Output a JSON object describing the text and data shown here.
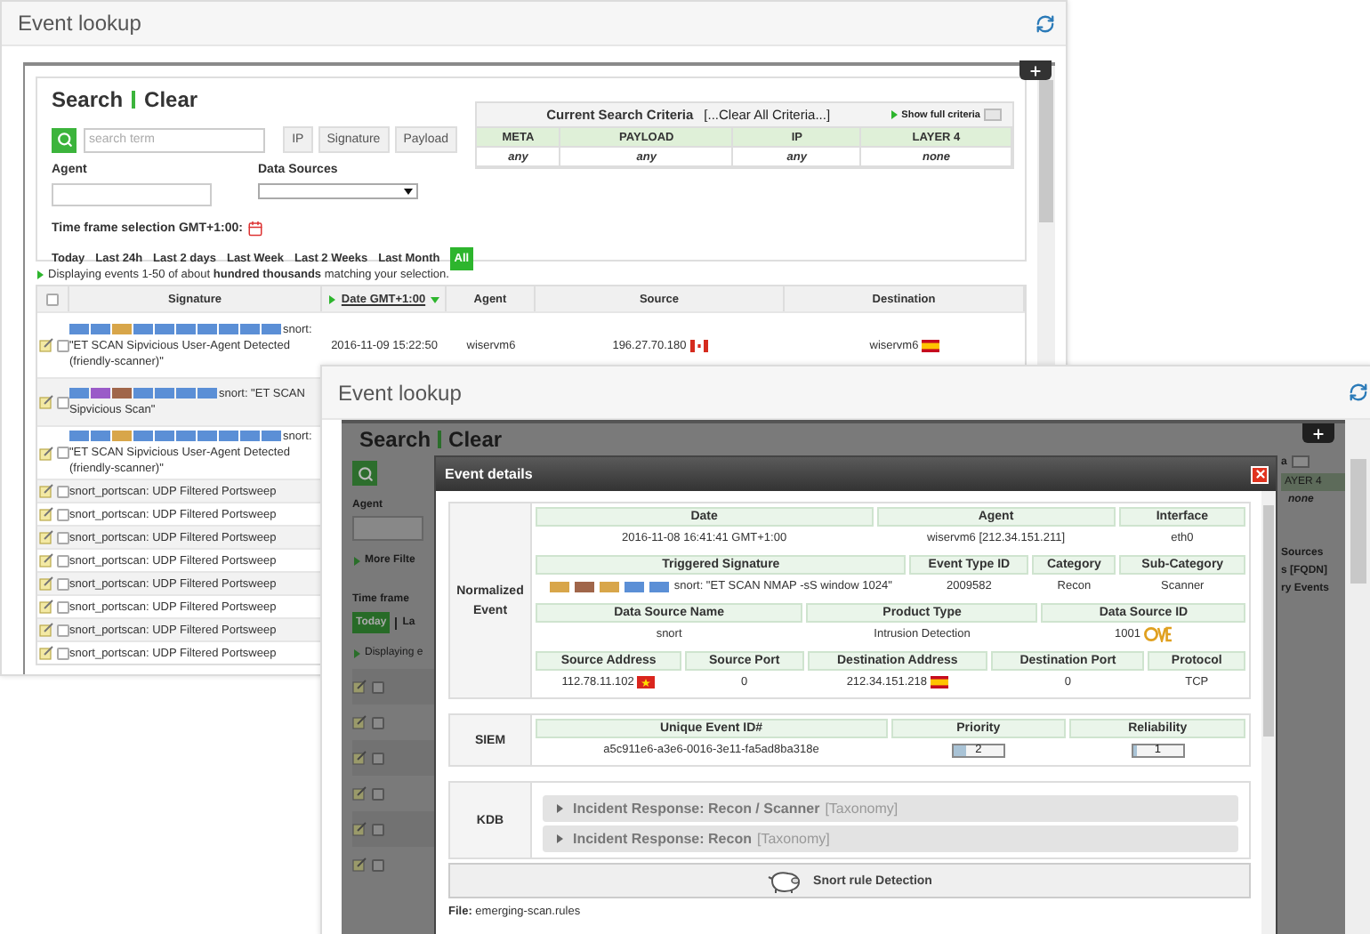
{
  "back_window": {
    "title": "Event lookup",
    "search": {
      "title": "Search",
      "clear": "Clear",
      "placeholder": "search term",
      "filter_buttons": [
        "IP",
        "Signature",
        "Payload"
      ],
      "agent_label": "Agent",
      "sources_label": "Data Sources",
      "timeframe_label": "Time frame selection GMT+1:00:",
      "time_links": [
        {
          "label": "Today",
          "selected": false
        },
        {
          "label": "Last 24h",
          "selected": false
        },
        {
          "label": "Last 2 days",
          "selected": false
        },
        {
          "label": "Last Week",
          "selected": false
        },
        {
          "label": "Last 2 Weeks",
          "selected": false
        },
        {
          "label": "Last Month",
          "selected": false
        },
        {
          "label": "All",
          "selected": true
        }
      ]
    },
    "criteria": {
      "title": "Current Search Criteria",
      "clear_link": "[...Clear All Criteria...]",
      "show_full": "Show full criteria",
      "columns": [
        "META",
        "PAYLOAD",
        "IP",
        "LAYER 4"
      ],
      "values": [
        "any",
        "any",
        "any",
        "none"
      ]
    },
    "status": "Displaying events 1-50 of about **hundred thousands** matching your selection.",
    "table": {
      "all_checked": false,
      "columns": [
        "Signature",
        "Date GMT+1:00",
        "Agent",
        "Source",
        "Destination"
      ],
      "rows": [
        {
          "checked": false,
          "tags": [
            {
              "color": "#5b8fd6"
            },
            {
              "color": "#5b8fd6"
            },
            {
              "color": "#d8a64a"
            },
            {
              "color": "#5b8fd6"
            },
            {
              "color": "#5b8fd6"
            },
            {
              "color": "#5b8fd6"
            },
            {
              "color": "#5b8fd6"
            },
            {
              "color": "#5b8fd6"
            },
            {
              "color": "#5b8fd6"
            },
            {
              "color": "#5b8fd6"
            }
          ],
          "signature": "snort: \"ET SCAN Sipvicious User-Agent Detected (friendly-scanner)\"",
          "date": "2016-11-09 15:22:50",
          "agent": "wiservm6",
          "source": "196.27.70.180",
          "source_flag": {
            "kind": "ca"
          },
          "destination": "wiservm6",
          "destination_flag": {
            "kind": "es"
          }
        },
        {
          "checked": false,
          "tags": [
            {
              "color": "#5b8fd6"
            },
            {
              "color": "#9a5bc8"
            },
            {
              "color": "#a0664a"
            },
            {
              "color": "#5b8fd6"
            },
            {
              "color": "#5b8fd6"
            },
            {
              "color": "#5b8fd6"
            },
            {
              "color": "#5b8fd6"
            }
          ],
          "signature": "snort: \"ET SCAN Sipvicious Scan\""
        },
        {
          "checked": false,
          "tags": [
            {
              "color": "#5b8fd6"
            },
            {
              "color": "#5b8fd6"
            },
            {
              "color": "#d8a64a"
            },
            {
              "color": "#5b8fd6"
            },
            {
              "color": "#5b8fd6"
            },
            {
              "color": "#5b8fd6"
            },
            {
              "color": "#5b8fd6"
            },
            {
              "color": "#5b8fd6"
            },
            {
              "color": "#5b8fd6"
            },
            {
              "color": "#5b8fd6"
            }
          ],
          "signature": "snort: \"ET SCAN Sipvicious User-Agent Detected (friendly-scanner)\""
        },
        {
          "checked": false,
          "signature": "snort_portscan: UDP Filtered Portsweep"
        },
        {
          "checked": false,
          "signature": "snort_portscan: UDP Filtered Portsweep"
        },
        {
          "checked": false,
          "signature": "snort_portscan: UDP Filtered Portsweep"
        },
        {
          "checked": false,
          "signature": "snort_portscan: UDP Filtered Portsweep"
        },
        {
          "checked": false,
          "signature": "snort_portscan: UDP Filtered Portsweep"
        },
        {
          "checked": false,
          "signature": "snort_portscan: UDP Filtered Portsweep"
        },
        {
          "checked": false,
          "signature": "snort_portscan: UDP Filtered Portsweep"
        },
        {
          "checked": false,
          "signature": "snort_portscan: UDP Filtered Portsweep"
        }
      ]
    }
  },
  "front_window": {
    "title": "Event lookup",
    "dimmed_top": {
      "search": "Search",
      "clear": "Clear"
    },
    "dimmed_left": {
      "agent_label": "Agent",
      "more_filters": "More Filte",
      "time_frame": "Time frame",
      "time_links": [
        {
          "label": "Today",
          "selected": true
        },
        {
          "label": "La",
          "selected": false
        }
      ],
      "status": "Displaying e",
      "rows": [
        {
          "checked": false
        },
        {
          "checked": false
        },
        {
          "checked": false
        },
        {
          "checked": false
        },
        {
          "checked": false
        },
        {
          "checked": false
        }
      ]
    },
    "dimmed_right": {
      "criteria_end": "a",
      "layer": "AYER 4",
      "layer_value": "none",
      "texts": [
        "Sources",
        "s [FQDN]",
        "ry Events"
      ]
    },
    "dialog": {
      "title": "Event details",
      "sections": [
        {
          "kind": "tables",
          "label": "Normalized Event",
          "tables": [
            {
              "columns": [
                "Date",
                "Agent",
                "Interface"
              ],
              "cells": [
                {
                  "text": "2016-11-08 16:41:41 GMT+1:00"
                },
                {
                  "text": "wiservm6 [212.34.151.211]"
                },
                {
                  "text": "eth0"
                }
              ]
            },
            {
              "columns": [
                "Triggered Signature",
                "Event Type ID",
                "Category",
                "Sub-Category"
              ],
              "cells": [
                {
                  "text": "snort: \"ET SCAN NMAP -sS window 1024\"",
                  "tags": [
                    {
                      "color": "#d8a64a"
                    },
                    {
                      "color": "#a0664a"
                    },
                    {
                      "color": "#d8a64a"
                    },
                    {
                      "color": "#5b8fd6"
                    },
                    {
                      "color": "#5b8fd6"
                    }
                  ]
                },
                {
                  "text": "2009582"
                },
                {
                  "text": "Recon"
                },
                {
                  "text": "Scanner"
                }
              ]
            },
            {
              "columns": [
                "Data Source Name",
                "Product Type",
                "Data Source ID"
              ],
              "cells": [
                {
                  "text": "snort"
                },
                {
                  "text": "Intrusion Detection"
                },
                {
                  "text": "1001",
                  "logo": true
                }
              ]
            },
            {
              "columns": [
                "Source Address",
                "Source Port",
                "Destination Address",
                "Destination Port",
                "Protocol"
              ],
              "cells": [
                {
                  "text": "112.78.11.102",
                  "flag": {
                    "kind": "vn"
                  }
                },
                {
                  "text": "0"
                },
                {
                  "text": "212.34.151.218",
                  "flag": {
                    "kind": "es"
                  }
                },
                {
                  "text": "0"
                },
                {
                  "text": "TCP"
                }
              ]
            }
          ]
        },
        {
          "kind": "tables",
          "label": "SIEM",
          "tables": [
            {
              "columns": [
                "Unique Event ID#",
                "Priority",
                "Reliability"
              ],
              "cells": [
                {
                  "text": "a5c911e6-a3e6-0016-3e11-fa5ad8ba318e"
                },
                {
                  "text": "2",
                  "level": 0.25
                },
                {
                  "text": "1",
                  "level": 0.1
                }
              ]
            }
          ]
        },
        {
          "kind": "kdb",
          "label": "KDB",
          "items": [
            {
              "title": "Incident Response: Recon / Scanner",
              "tag": "[Taxonomy]",
              "expanded": false
            },
            {
              "title": "Incident Response: Recon",
              "tag": "[Taxonomy]",
              "expanded": false
            }
          ]
        }
      ],
      "rule_button": "Snort rule Detection",
      "file": "**File:** emerging-scan.rules"
    }
  }
}
